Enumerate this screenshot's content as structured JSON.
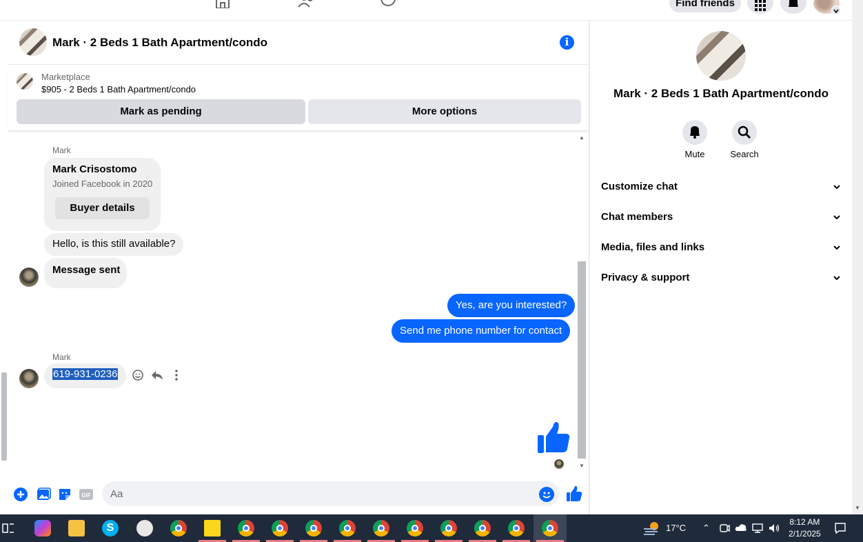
{
  "topbar": {
    "find_friends": "Find friends"
  },
  "chat": {
    "title": "Mark · 2 Beds 1 Bath Apartment/condo",
    "marketplace": {
      "label": "Marketplace",
      "listing": "$905 - 2 Beds 1 Bath Apartment/condo",
      "pending_button": "Mark as pending",
      "more_button": "More options"
    },
    "messages": {
      "sender_top": "Mark",
      "profile_card": {
        "name": "Mark Crisostomo",
        "joined": "Joined Facebook in 2020",
        "button": "Buyer details"
      },
      "incoming_1": "Hello, is this still available?",
      "incoming_2": "Message sent",
      "outgoing_1": "Yes, are you interested?",
      "outgoing_2": "Send me phone number for contact",
      "sender_bottom": "Mark",
      "phone": "619-931-0236"
    },
    "composer": {
      "placeholder": "Aa"
    }
  },
  "right_panel": {
    "title": "Mark · 2 Beds 1 Bath Apartment/condo",
    "actions": [
      {
        "label": "Mute",
        "icon": "bell-icon"
      },
      {
        "label": "Search",
        "icon": "search-icon"
      }
    ],
    "sections": [
      "Customize chat",
      "Chat members",
      "Media, files and links",
      "Privacy & support"
    ]
  },
  "taskbar": {
    "temperature": "17°C",
    "time": "8:12 AM",
    "date": "2/1/2025"
  },
  "colors": {
    "accent": "#0866ff",
    "bubble_in": "#f0f0f0",
    "taskbar": "#1f2a3a"
  }
}
